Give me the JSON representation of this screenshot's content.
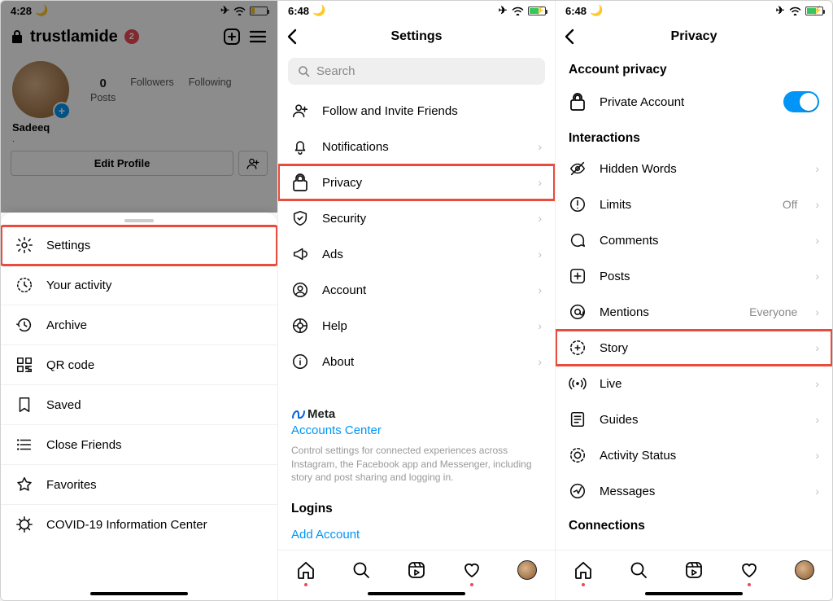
{
  "pane1": {
    "status": {
      "time": "4:28",
      "moon": true,
      "battery_level": "low"
    },
    "header": {
      "username": "trustlamide",
      "notifications": "2"
    },
    "stats": {
      "posts_num": "0",
      "posts_label": "Posts",
      "followers_label": "Followers",
      "following_label": "Following"
    },
    "display_name": "Sadeeq",
    "edit_profile_label": "Edit Profile",
    "sheet_items": [
      {
        "icon": "gear",
        "label": "Settings",
        "highlighted": true
      },
      {
        "icon": "clock-dotted",
        "label": "Your activity"
      },
      {
        "icon": "history",
        "label": "Archive"
      },
      {
        "icon": "qr",
        "label": "QR code"
      },
      {
        "icon": "bookmark",
        "label": "Saved"
      },
      {
        "icon": "list-star",
        "label": "Close Friends"
      },
      {
        "icon": "star",
        "label": "Favorites"
      },
      {
        "icon": "covid",
        "label": "COVID-19 Information Center"
      }
    ]
  },
  "pane2": {
    "status": {
      "time": "6:48",
      "moon": true,
      "battery_level": "charging"
    },
    "title": "Settings",
    "search_placeholder": "Search",
    "rows": [
      {
        "icon": "person-plus",
        "label": "Follow and Invite Friends",
        "chev": false
      },
      {
        "icon": "bell",
        "label": "Notifications",
        "chev": true
      },
      {
        "icon": "lock",
        "label": "Privacy",
        "chev": true,
        "highlighted": true
      },
      {
        "icon": "shield",
        "label": "Security",
        "chev": true
      },
      {
        "icon": "megaphone",
        "label": "Ads",
        "chev": true
      },
      {
        "icon": "account",
        "label": "Account",
        "chev": true
      },
      {
        "icon": "help",
        "label": "Help",
        "chev": true
      },
      {
        "icon": "info",
        "label": "About",
        "chev": true
      }
    ],
    "meta": {
      "brand": "Meta",
      "link": "Accounts Center",
      "desc": "Control settings for connected experiences across Instagram, the Facebook app and Messenger, including story and post sharing and logging in."
    },
    "logins_header": "Logins",
    "add_account": "Add Account"
  },
  "pane3": {
    "status": {
      "time": "6:48",
      "moon": true,
      "battery_level": "charging"
    },
    "title": "Privacy",
    "account_privacy_header": "Account privacy",
    "private_account_label": "Private Account",
    "interactions_header": "Interactions",
    "rows": [
      {
        "icon": "eye-hidden",
        "label": "Hidden Words",
        "trail": ""
      },
      {
        "icon": "alert",
        "label": "Limits",
        "trail": "Off"
      },
      {
        "icon": "comment",
        "label": "Comments",
        "trail": ""
      },
      {
        "icon": "plus-square",
        "label": "Posts",
        "trail": ""
      },
      {
        "icon": "mention",
        "label": "Mentions",
        "trail": "Everyone"
      },
      {
        "icon": "story-plus",
        "label": "Story",
        "trail": "",
        "highlighted": true
      },
      {
        "icon": "live",
        "label": "Live",
        "trail": ""
      },
      {
        "icon": "guides",
        "label": "Guides",
        "trail": ""
      },
      {
        "icon": "activity",
        "label": "Activity Status",
        "trail": ""
      },
      {
        "icon": "messages",
        "label": "Messages",
        "trail": ""
      }
    ],
    "connections_header": "Connections"
  }
}
